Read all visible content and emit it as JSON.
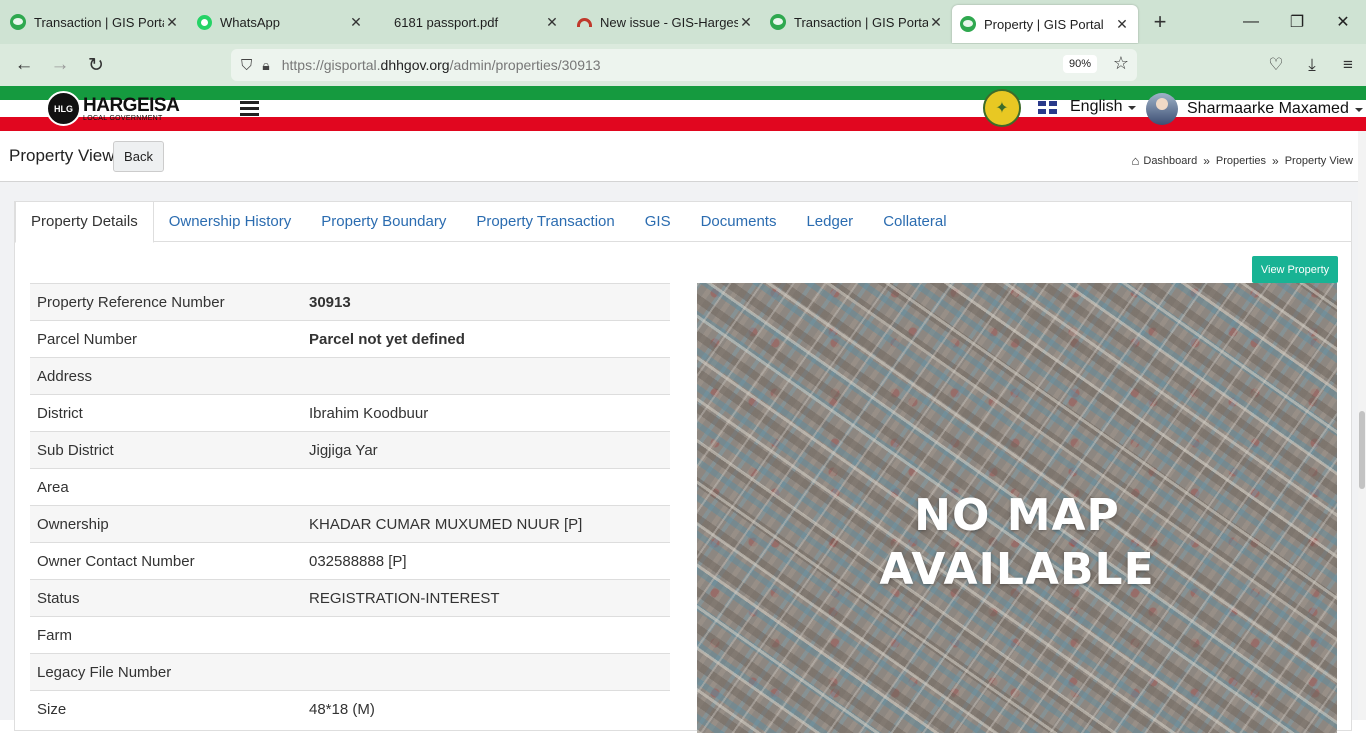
{
  "browser": {
    "tabs": [
      {
        "title": "Transaction | GIS Portal",
        "icon": "gis-portal-icon",
        "active": false
      },
      {
        "title": "WhatsApp",
        "icon": "whatsapp-icon",
        "active": false
      },
      {
        "title": "6181 passport.pdf",
        "icon": "",
        "active": false
      },
      {
        "title": "New issue - GIS-Hargesia",
        "icon": "gitlab-icon",
        "active": false
      },
      {
        "title": "Transaction | GIS Portal",
        "icon": "gis-portal-icon",
        "active": false
      },
      {
        "title": "Property | GIS Portal",
        "icon": "gis-portal-icon",
        "active": true
      }
    ],
    "url_prefix": "https://gisportal.",
    "url_domain": "dhhgov.org",
    "url_path": "/admin/properties/30913",
    "zoom": "90%"
  },
  "header": {
    "logo_initials": "HLG",
    "logo_title": "HARGEISA",
    "logo_subtitle": "LOCAL GOVERNMENT",
    "language": "English",
    "user_name": "Sharmaarke Maxamed"
  },
  "page": {
    "title": "Property View",
    "back_label": "Back",
    "breadcrumb": [
      "Dashboard",
      "Properties",
      "Property View"
    ]
  },
  "tabs": [
    "Property Details",
    "Ownership History",
    "Property Boundary",
    "Property Transaction",
    "GIS",
    "Documents",
    "Ledger",
    "Collateral"
  ],
  "view_property_label": "View Property",
  "details": [
    {
      "label": "Property Reference Number",
      "value": "30913",
      "style": "link"
    },
    {
      "label": "Parcel Number",
      "value": "Parcel not yet defined",
      "style": "bold"
    },
    {
      "label": "Address",
      "value": "",
      "style": ""
    },
    {
      "label": "District",
      "value": "Ibrahim Koodbuur",
      "style": ""
    },
    {
      "label": "Sub District",
      "value": "Jigjiga Yar",
      "style": ""
    },
    {
      "label": "Area",
      "value": "",
      "style": ""
    },
    {
      "label": "Ownership",
      "value": "KHADAR CUMAR MUXUMED NUUR [P]",
      "style": ""
    },
    {
      "label": "Owner Contact Number",
      "value": "032588888 [P]",
      "style": ""
    },
    {
      "label": "Status",
      "value": "REGISTRATION-INTEREST",
      "style": ""
    },
    {
      "label": "Farm",
      "value": "",
      "style": ""
    },
    {
      "label": "Legacy File Number",
      "value": "",
      "style": ""
    },
    {
      "label": "Size",
      "value": "48*18 (M)",
      "style": ""
    }
  ],
  "map": {
    "line1": "NO MAP",
    "line2": "AVAILABLE"
  },
  "colors": {
    "flag_green": "#159a3f",
    "flag_red": "#e1061f",
    "accent_teal": "#18b394",
    "link_blue": "#2b6cb0"
  }
}
